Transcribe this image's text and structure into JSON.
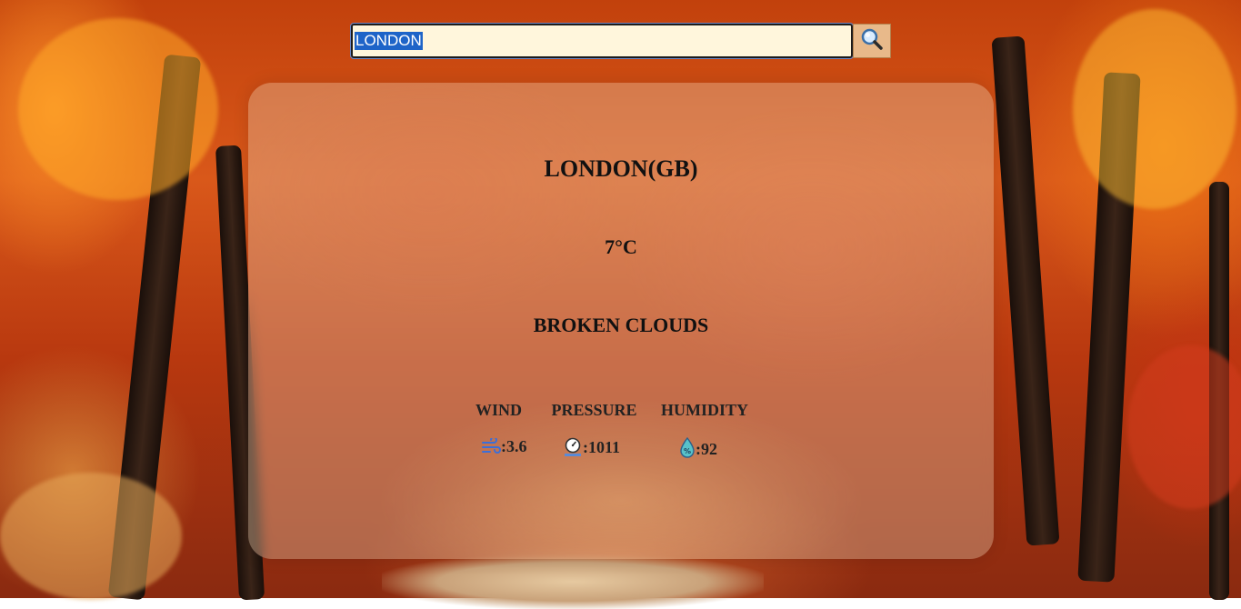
{
  "search": {
    "value": "LONDON"
  },
  "weather": {
    "city": "LONDON(GB)",
    "temperature": "7°C",
    "description": "BROKEN CLOUDS"
  },
  "stats": {
    "labels": {
      "wind": "WIND",
      "pressure": "PRESSURE",
      "humidity": "HUMIDITY"
    },
    "values": {
      "wind": ":3.6",
      "pressure": ":1011",
      "humidity": ":92"
    }
  },
  "icons": {
    "search": "search-icon",
    "wind": "wind-icon",
    "pressure": "pressure-gauge-icon",
    "humidity": "humidity-drop-icon"
  },
  "colors": {
    "search_field_bg": "#fff6dc",
    "search_button_bg": "#e8b98a",
    "selection": "#1e64c8",
    "text": "#111111"
  }
}
